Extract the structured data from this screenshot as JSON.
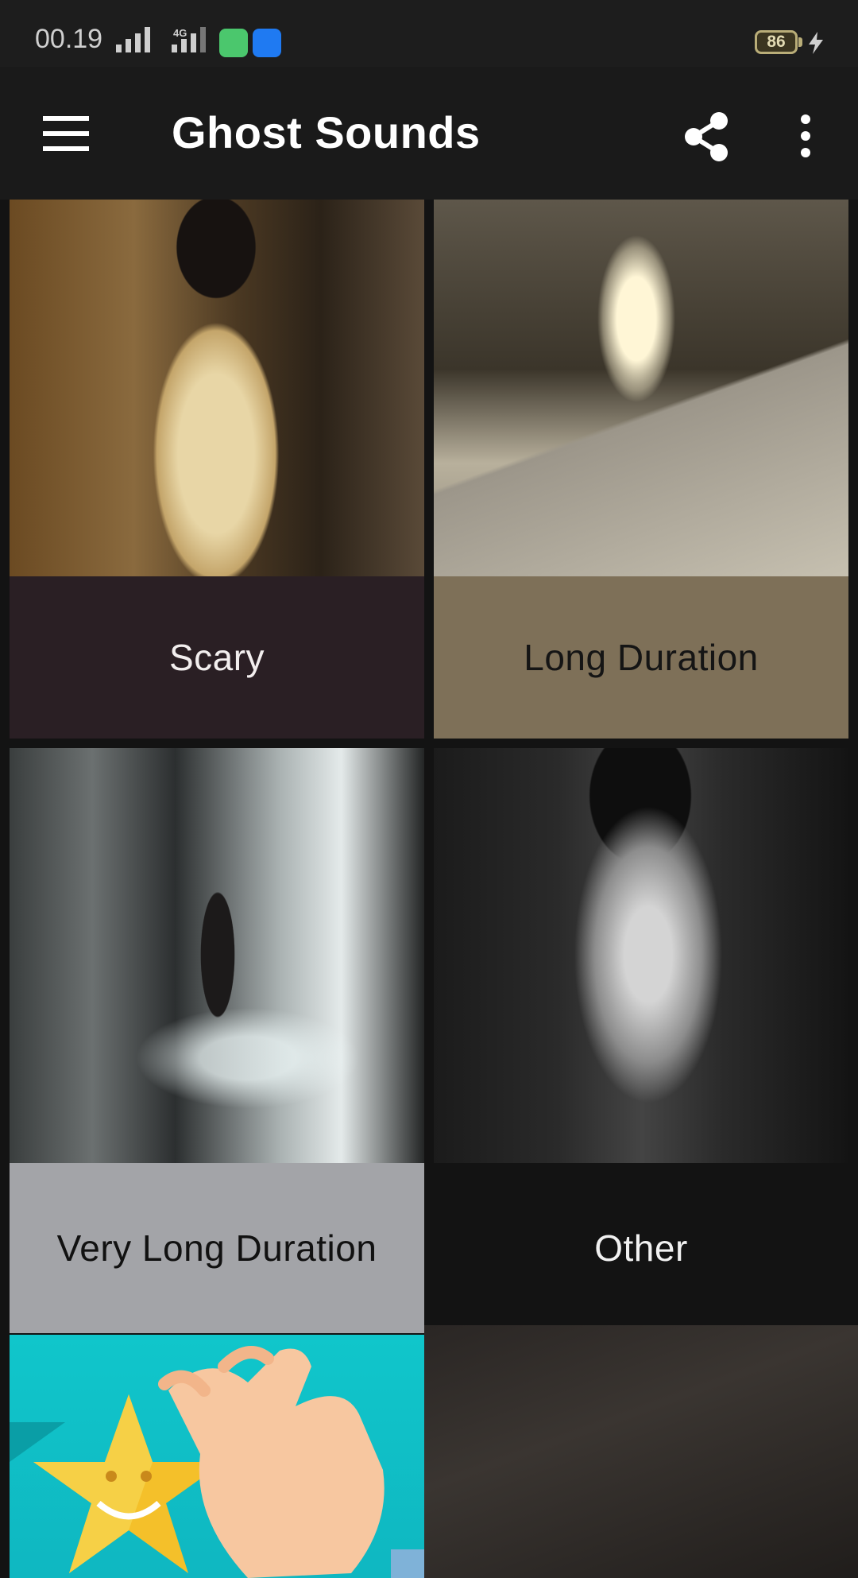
{
  "status_bar": {
    "time": "00.19",
    "network_type": "4G",
    "battery_level": "86"
  },
  "app_bar": {
    "title": "Ghost Sounds",
    "menu_icon": "hamburger-menu-icon",
    "share_icon": "share-icon",
    "more_icon": "more-vert-icon"
  },
  "categories": [
    {
      "label": "Scary",
      "image": "woman-in-white-dress-ghost-image"
    },
    {
      "label": "Long Duration",
      "image": "ghost-on-road-image"
    },
    {
      "label": "Very Long Duration",
      "image": "girl-in-doorway-image"
    },
    {
      "label": "Other",
      "image": "ghost-long-hair-image"
    },
    {
      "label": "",
      "image": "rate-app-star-hand-image"
    },
    {
      "label": "",
      "image": "dark-corridor-image"
    }
  ],
  "colors": {
    "status_bar_bg": "#1d1d1d",
    "app_bar_bg": "#1a1a1a",
    "scary_label_bg": "#2a1f24",
    "long_duration_label_bg": "#7e7058",
    "very_long_duration_label_bg": "#a3a4a8",
    "other_label_bg": "#131313",
    "rate_card_bg": "#10c6cb"
  }
}
